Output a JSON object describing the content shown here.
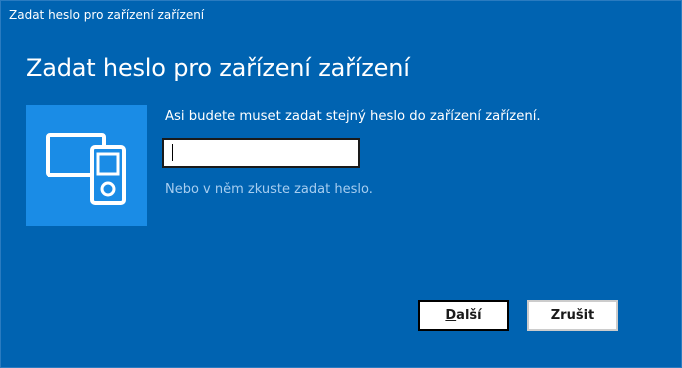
{
  "window": {
    "title": "Zadat heslo pro zařízení zařízení"
  },
  "dialog": {
    "heading": "Zadat heslo pro zařízení zařízení",
    "prompt": "Asi budete muset zadat stejný heslo do zařízení zařízení.",
    "pin_input": {
      "value": "",
      "placeholder": ""
    },
    "hint": "Nebo v něm zkuste zadat heslo.",
    "device_icon": "devices-icon"
  },
  "buttons": {
    "next_mnemonic": "D",
    "next_rest": "alší",
    "cancel_label": "Zrušit"
  },
  "colors": {
    "background": "#0063b1",
    "tile": "#1a8ce6",
    "hint_text": "#a6cdf0"
  }
}
